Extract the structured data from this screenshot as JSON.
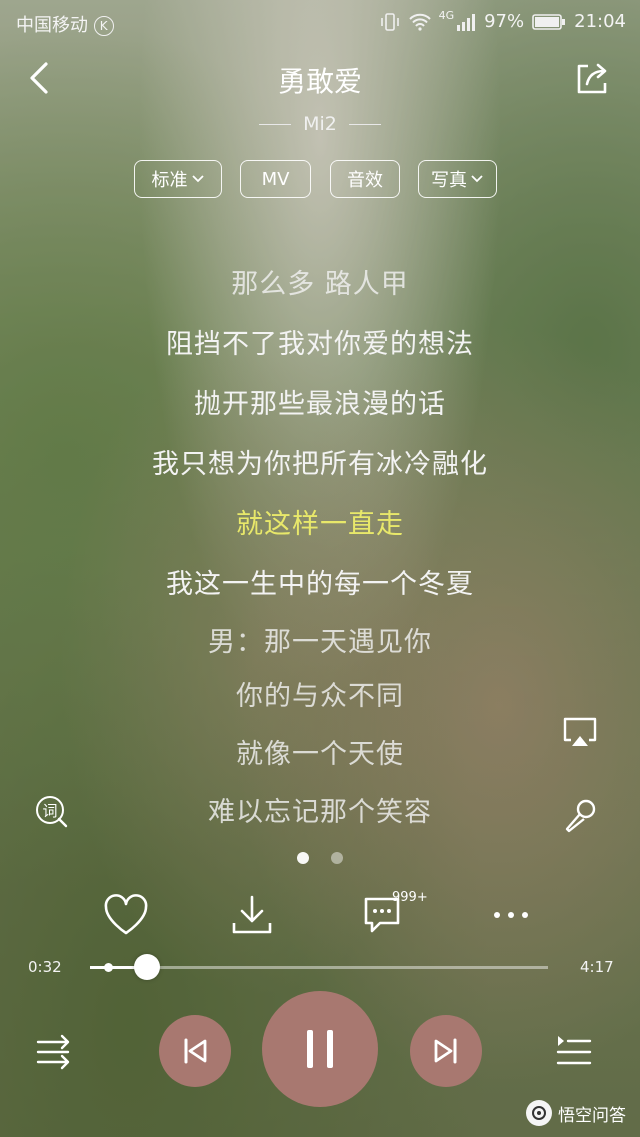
{
  "status": {
    "carrier": "中国移动",
    "network": "4G",
    "battery": "97%",
    "time": "21:04"
  },
  "header": {
    "title": "勇敢爱",
    "artist": "Mi2"
  },
  "chips": [
    "标准",
    "MV",
    "音效",
    "写真"
  ],
  "lyrics": [
    "那么多 路人甲",
    "阻挡不了我对你爱的想法",
    "抛开那些最浪漫的话",
    "我只想为你把所有冰冷融化",
    "就这样一直走",
    "我这一生中的每一个冬夏",
    "男：那一天遇见你",
    "你的与众不同",
    "就像一个天使",
    "难以忘记那个笑容"
  ],
  "lyric_current_color": "#e8e86a",
  "lyric_icon_label": "词",
  "comments_badge": "999+",
  "progress": {
    "elapsed": "0:32",
    "total": "4:17",
    "fraction": 0.125
  },
  "accent_color": "#a87870",
  "watermark": "悟空问答",
  "icons": [
    "back-icon",
    "share-icon",
    "cast-icon",
    "mic-icon",
    "heart-icon",
    "download-icon",
    "comment-icon",
    "more-icon",
    "shuffle-icon",
    "prev-icon",
    "pause-icon",
    "next-icon",
    "playlist-icon"
  ]
}
